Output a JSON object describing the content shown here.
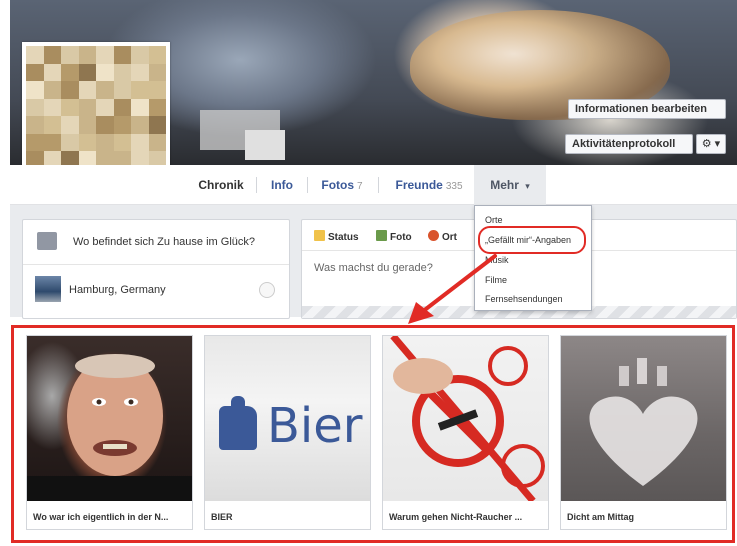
{
  "cover": {
    "edit_info_label": "Informationen bearbeiten",
    "activity_log_label": "Aktivitätenprotokoll",
    "gear_label": "⚙ ▾"
  },
  "nav": {
    "tabs": [
      {
        "label": "Chronik",
        "count": ""
      },
      {
        "label": "Info",
        "count": ""
      },
      {
        "label": "Fotos",
        "count": "7"
      },
      {
        "label": "Freunde",
        "count": "335"
      },
      {
        "label": "Mehr",
        "count": "▾"
      }
    ]
  },
  "dropdown": {
    "items": [
      "Orte",
      "„Gefällt mir“-Angaben",
      "Musik",
      "Filme",
      "Fernsehsendungen"
    ]
  },
  "places": {
    "question": "Wo befindet sich Zu hause im Glück?",
    "place": "Hamburg, Germany"
  },
  "composer": {
    "tabs": [
      "Status",
      "Foto",
      "Ort"
    ],
    "prompt": "Was machst du gerade?"
  },
  "likes": {
    "items": [
      {
        "caption": "Wo war ich eigentlich in der N..."
      },
      {
        "caption": "BIER",
        "image_text": "Bier"
      },
      {
        "caption": "Warum gehen Nicht-Raucher ..."
      },
      {
        "caption": "Dicht am Mittag"
      }
    ]
  },
  "colors": {
    "accent": "#3b5998",
    "highlight_red": "#e12b25"
  }
}
